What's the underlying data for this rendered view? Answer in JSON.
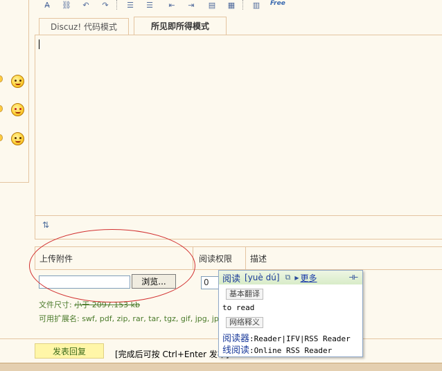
{
  "toolbar": {
    "icons": [
      "remove-format-icon",
      "link-icon",
      "undo-icon",
      "redo-icon",
      "ordered-list-icon",
      "unordered-list-icon",
      "outdent-icon",
      "indent-icon",
      "align-icon",
      "table-icon",
      "grid-icon"
    ],
    "free_label": "Free"
  },
  "tabs": {
    "code_mode": "Discuz! 代码模式",
    "wysiwyg_mode": "所见即所得模式"
  },
  "upload": {
    "col_attach": "上传附件",
    "col_permission": "阅读权限",
    "col_description": "描述",
    "browse_label": "浏览...",
    "permission_value": "0",
    "size_note_prefix": "文件尺寸: ",
    "size_note_struck": "小于  2097.153 kb",
    "ext_note": "可用扩展名: swf, pdf, zip, rar, tar, tgz, gif, jpg, jpeg"
  },
  "bottom": {
    "submit_label": "发表回复",
    "hint": "[完成后可按  Ctrl+Enter 发布]"
  },
  "dictionary": {
    "word": "阅读",
    "pinyin": "[yuè dú]",
    "more_label": "更多",
    "basic_section": "基本翻译",
    "basic_text": "to read",
    "web_section": "网络释义",
    "web_entry1_cn": "阅读器",
    "web_entry1_en": ":Reader|IFV|RSS Reader",
    "web_entry2_cn": "线阅读",
    "web_entry2_en": ":Online RSS Reader"
  },
  "colors": {
    "border": "#e4c4a0",
    "background": "#fdf9ee",
    "annotation": "#d23030",
    "submit_bg": "#fff6a8"
  }
}
